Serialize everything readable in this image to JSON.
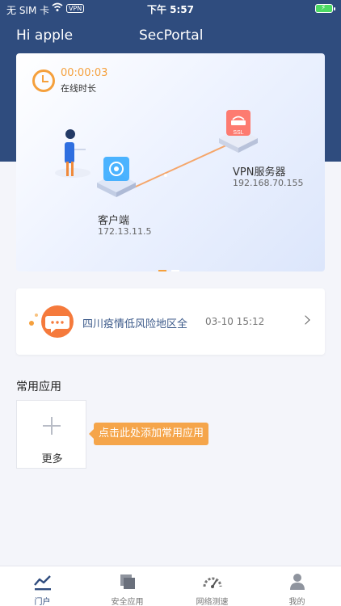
{
  "status_bar": {
    "carrier": "无 SIM 卡",
    "vpn_badge": "VPN",
    "time": "下午 5:57"
  },
  "header": {
    "greeting": "Hi apple",
    "title": "SecPortal"
  },
  "hero": {
    "online_duration": "00:00:03",
    "online_duration_label": "在线时长",
    "client": {
      "name": "客户端",
      "ip": "172.13.11.5"
    },
    "server": {
      "name": "VPN服务器",
      "ip": "192.168.70.155",
      "badge": "SSL"
    },
    "page_count": 2,
    "active_page": 1
  },
  "notice": {
    "text": "四川疫情低风险地区全",
    "time": "03-10 15:12"
  },
  "apps": {
    "title": "常用应用",
    "more_label": "更多",
    "tip": "点击此处添加常用应用"
  },
  "tabs": [
    {
      "label": "门户",
      "icon": "portal-chart-icon",
      "active": true
    },
    {
      "label": "安全应用",
      "icon": "apps-stack-icon",
      "active": false
    },
    {
      "label": "网络测速",
      "icon": "speedometer-icon",
      "active": false
    },
    {
      "label": "我的",
      "icon": "person-icon",
      "active": false
    }
  ],
  "colors": {
    "header": "#2f4c7e",
    "accent": "#f5a03c",
    "tip": "#f5a54a",
    "server": "#ff6a5c",
    "client": "#2ea7ff"
  }
}
